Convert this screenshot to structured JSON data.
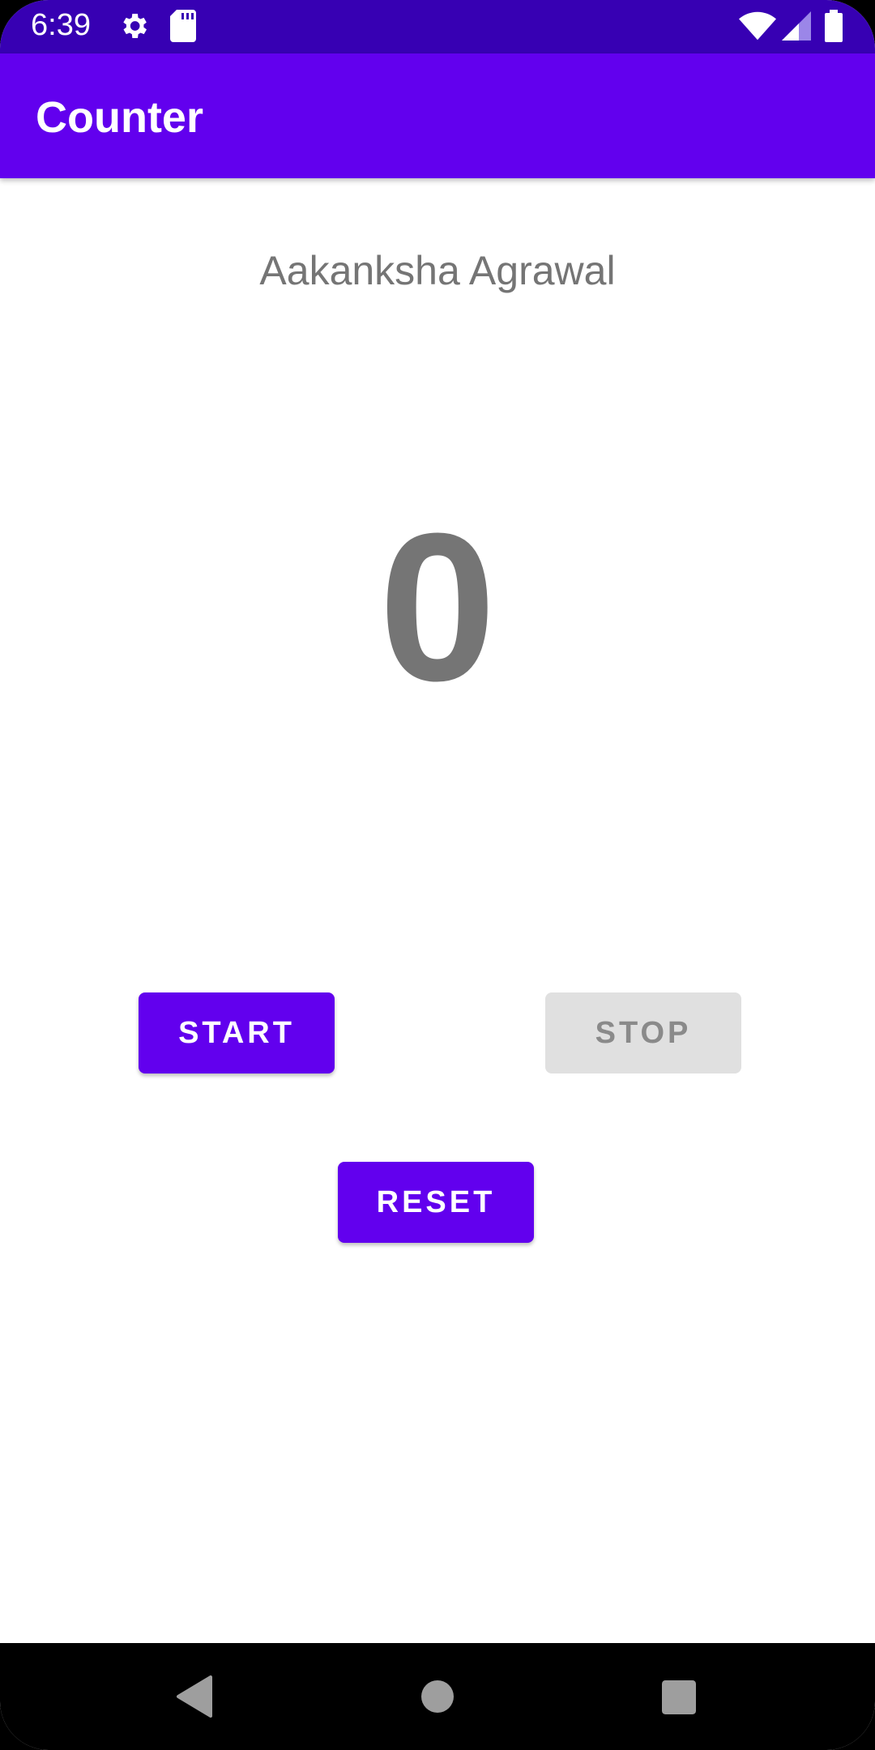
{
  "status_bar": {
    "time": "6:39",
    "icons": [
      "gear-icon",
      "sd-card-icon",
      "wifi-icon",
      "cell-signal-icon",
      "battery-icon"
    ]
  },
  "app_bar": {
    "title": "Counter"
  },
  "main": {
    "name": "Aakanksha Agrawal",
    "counter": "0"
  },
  "buttons": {
    "start": "START",
    "stop": "STOP",
    "reset": "RESET"
  },
  "nav_bar": {
    "icons": [
      "back-icon",
      "home-icon",
      "recents-icon"
    ]
  },
  "colors": {
    "primary": "#6200ee",
    "primary_dark": "#3700b3",
    "text_gray": "#757575",
    "disabled_bg": "#e0e0e0"
  }
}
